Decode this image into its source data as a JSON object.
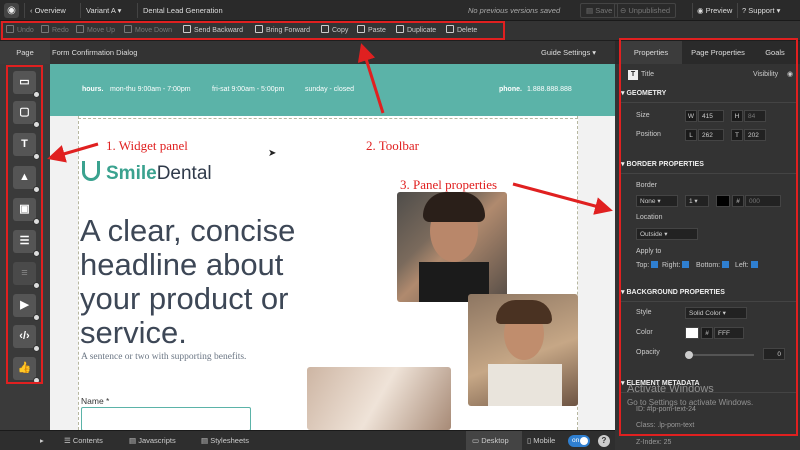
{
  "topbar": {
    "back_label": "Overview",
    "variant_label": "Variant A",
    "page_name": "Dental Lead Generation",
    "status_text": "No previous versions saved",
    "save_label": "Save",
    "unpublished_label": "Unpublished",
    "preview_label": "Preview",
    "support_label": "Support"
  },
  "toolbar": {
    "tools": [
      {
        "label": "Undo",
        "enabled": false
      },
      {
        "label": "Redo",
        "enabled": false
      },
      {
        "label": "Move Up",
        "enabled": false
      },
      {
        "label": "Move Down",
        "enabled": false
      },
      {
        "label": "Send Backward",
        "enabled": true
      },
      {
        "label": "Bring Forward",
        "enabled": true
      },
      {
        "label": "Copy",
        "enabled": true
      },
      {
        "label": "Paste",
        "enabled": true
      },
      {
        "label": "Duplicate",
        "enabled": true
      },
      {
        "label": "Delete",
        "enabled": true
      }
    ]
  },
  "subbar": {
    "page_tab": "Page",
    "dialog_tab": "Form Confirmation Dialog",
    "guide_settings": "Guide Settings"
  },
  "widgets": [
    {
      "icon": "section-icon"
    },
    {
      "icon": "box-icon"
    },
    {
      "icon": "text-icon",
      "glyph": "T"
    },
    {
      "icon": "image-icon"
    },
    {
      "icon": "lightbox-icon"
    },
    {
      "icon": "form-icon"
    },
    {
      "icon": "social-widget-icon"
    },
    {
      "icon": "video-icon"
    },
    {
      "icon": "custom-html-icon"
    },
    {
      "icon": "social-like-icon"
    }
  ],
  "canvas": {
    "hours_label": "hours.",
    "hours_weekday": "mon-thu 9:00am - 7:00pm",
    "hours_friday": "fri-sat 9:00am - 5:00pm",
    "hours_sunday": "sunday - closed",
    "phone_label": "phone.",
    "phone_number": "1.888.888.888",
    "brand_smile": "Smile",
    "brand_dental": "Dental",
    "headline": "A clear, concise headline about your product or service.",
    "subline": "A sentence or two with supporting benefits.",
    "name_label": "Name *"
  },
  "bottombar": {
    "contents": "Contents",
    "javascripts": "Javascripts",
    "stylesheets": "Stylesheets",
    "desktop": "Desktop",
    "mobile": "Mobile",
    "mobile_toggle": "on",
    "help": "?"
  },
  "rpanel": {
    "tabs": [
      "Properties",
      "Page Properties",
      "Goals"
    ],
    "element_type": "Title",
    "visibility_label": "Visibility",
    "geometry": {
      "heading": "GEOMETRY",
      "size_label": "Size",
      "w_key": "W",
      "w_value": "415",
      "h_key": "H",
      "h_value": "84",
      "position_label": "Position",
      "l_key": "L",
      "l_value": "262",
      "t_key": "T",
      "t_value": "202"
    },
    "border": {
      "heading": "BORDER PROPERTIES",
      "border_label": "Border",
      "style_value": "None",
      "width_value": "1",
      "hash": "#",
      "color_value": "000",
      "location_label": "Location",
      "location_value": "Outside",
      "apply_label": "Apply to",
      "top": "Top:",
      "right": "Right:",
      "bottom": "Bottom:",
      "left": "Left:"
    },
    "background": {
      "heading": "BACKGROUND PROPERTIES",
      "style_label": "Style",
      "style_value": "Solid Color",
      "color_label": "Color",
      "hash": "#",
      "color_value": "FFF",
      "opacity_label": "Opacity",
      "opacity_value": "0"
    },
    "metadata": {
      "heading": "ELEMENT METADATA",
      "id_label": "ID:",
      "id_value": "#lp-pom-text-24",
      "class_label": "Class:",
      "class_value": ".lp-pom-text",
      "zindex_label": "Z-Index:",
      "zindex_value": "25"
    },
    "watermark_title": "Activate Windows",
    "watermark_sub": "Go to Settings to activate Windows."
  },
  "annotations": {
    "widget_panel": "1. Widget panel",
    "toolbar": "2. Toolbar",
    "panel_properties": "3. Panel properties"
  },
  "colors": {
    "accent_teal": "#5bb3a8",
    "annotation_red": "#e02020",
    "toggle_blue": "#2f7fd0"
  }
}
